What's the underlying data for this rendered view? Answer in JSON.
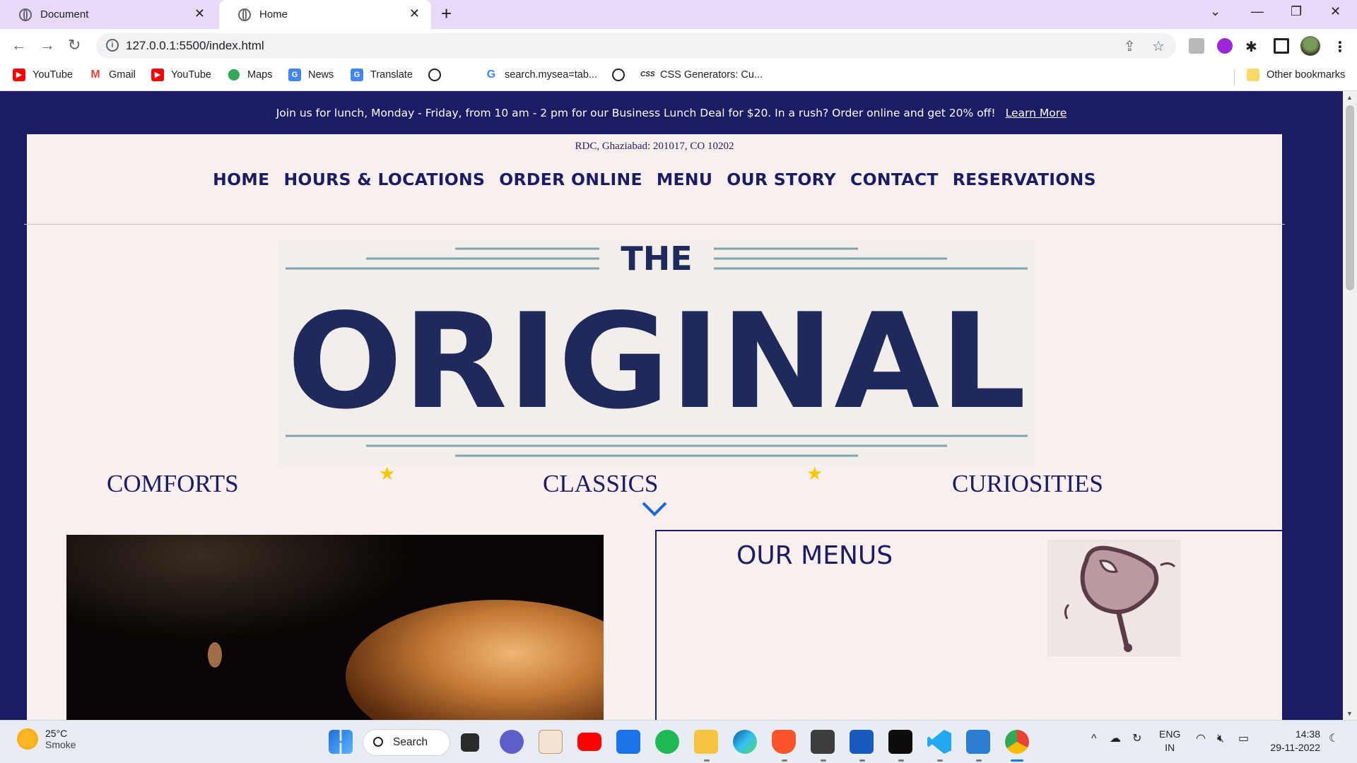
{
  "browser": {
    "tabs": [
      {
        "title": "Document"
      },
      {
        "title": "Home"
      }
    ],
    "new_tab": "+",
    "url": "127.0.0.1:5500/index.html",
    "bookmarks": [
      {
        "label": "YouTube",
        "icon": "youtube-icon"
      },
      {
        "label": "Gmail",
        "icon": "gmail-icon"
      },
      {
        "label": "YouTube",
        "icon": "youtube-icon"
      },
      {
        "label": "Maps",
        "icon": "maps-icon"
      },
      {
        "label": "News",
        "icon": "news-icon"
      },
      {
        "label": "Translate",
        "icon": "translate-icon"
      },
      {
        "label": "",
        "icon": "globe-icon"
      },
      {
        "label": "search.mysea=tab...",
        "icon": "google-icon"
      },
      {
        "label": "",
        "icon": "globe-icon"
      },
      {
        "label": "CSS Generators: Cu...",
        "icon": "css-icon"
      }
    ],
    "other_bookmarks": "Other bookmarks"
  },
  "page": {
    "promo": {
      "text": "Join us for lunch, Monday - Friday, from 10 am - 2 pm for our Business Lunch Deal for $20. In a rush? Order online and get 20% off!",
      "link": "Learn More"
    },
    "address": "RDC, Ghaziabad: 201017, CO 10202",
    "nav": [
      "HOME",
      "HOURS & LOCATIONS",
      "ORDER ONLINE",
      "MENU",
      "OUR STORY",
      "CONTACT",
      "RESERVATIONS"
    ],
    "logo": {
      "top": "THE",
      "main": "ORIGINAL"
    },
    "taglines": [
      "COMFORTS",
      "CLASSICS",
      "CURIOSITIES"
    ],
    "menus_title": "OUR MENUS",
    "colors": {
      "navy": "#1b1b66",
      "cream": "#f8f0ee",
      "star": "#f7c800",
      "logo_line": "#7ea6ad"
    }
  },
  "taskbar": {
    "weather": {
      "temp": "25°C",
      "condition": "Smoke"
    },
    "search": "Search",
    "lang": {
      "line1": "ENG",
      "line2": "IN"
    },
    "time": "14:38",
    "date": "29-11-2022"
  }
}
